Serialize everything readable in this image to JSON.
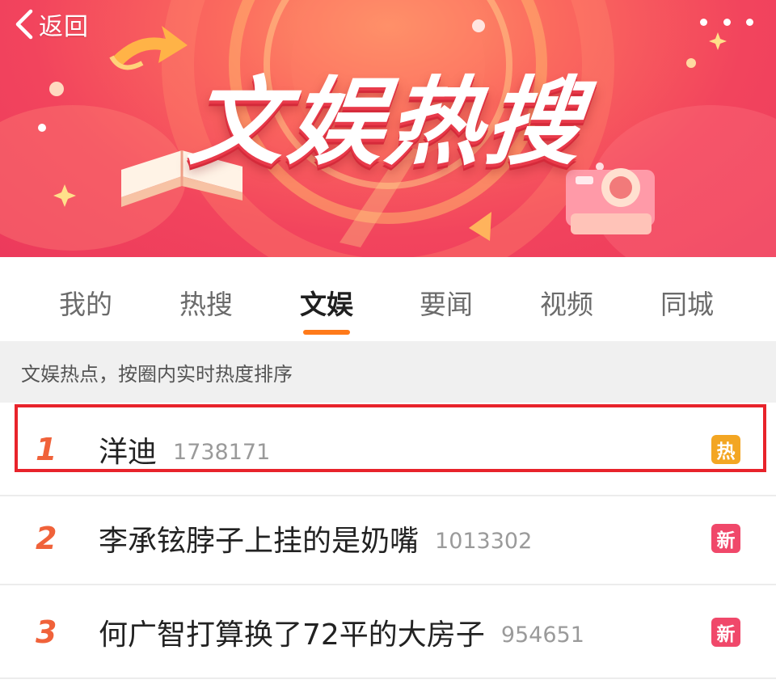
{
  "header": {
    "back_label": "返回",
    "banner_title": "文娱热搜"
  },
  "tabs": [
    {
      "label": "我的",
      "active": false
    },
    {
      "label": "热搜",
      "active": false
    },
    {
      "label": "文娱",
      "active": true
    },
    {
      "label": "要闻",
      "active": false
    },
    {
      "label": "视频",
      "active": false
    },
    {
      "label": "同城",
      "active": false
    }
  ],
  "subheader": {
    "text": "文娱热点，按圈内实时热度排序"
  },
  "list": {
    "items": [
      {
        "rank": "1",
        "title": "洋迪",
        "count": "1738171",
        "badge": "热",
        "badge_color": "#f3a623",
        "highlighted": true
      },
      {
        "rank": "2",
        "title": "李承铉脖子上挂的是奶嘴",
        "count": "1013302",
        "badge": "新",
        "badge_color": "#f0486a",
        "highlighted": false
      },
      {
        "rank": "3",
        "title": "何广智打算换了72平的大房子",
        "count": "954651",
        "badge": "新",
        "badge_color": "#f0486a",
        "highlighted": false
      }
    ]
  },
  "colors": {
    "accent": "#ff7a1a",
    "rank": "#f0623a",
    "highlight_border": "#e8232b"
  },
  "icons": {
    "back": "chevron-left-icon",
    "more": "more-dots-icon"
  }
}
